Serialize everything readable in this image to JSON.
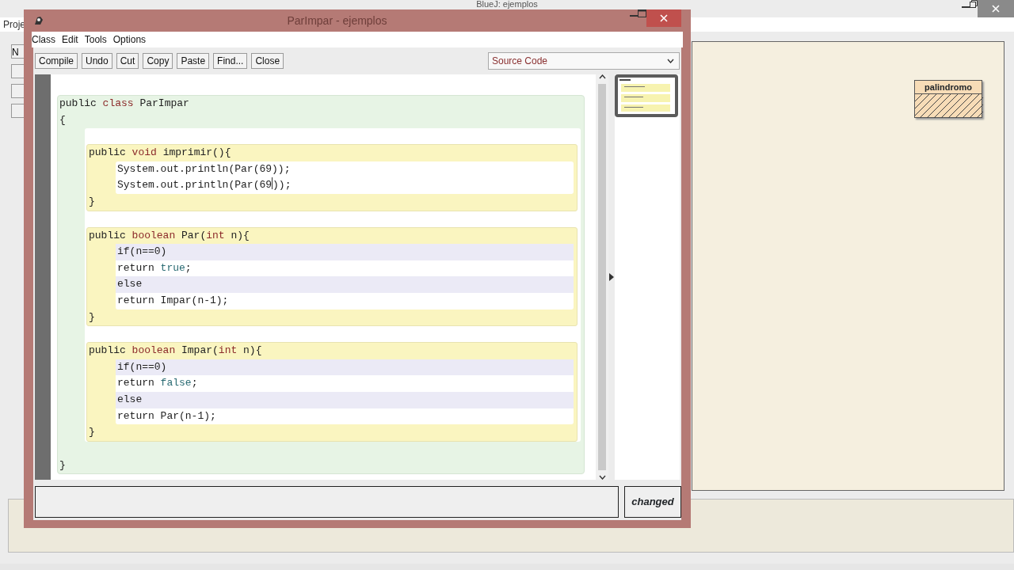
{
  "background_window": {
    "title": "BlueJ: ejemplos",
    "menu": [
      "Proje"
    ],
    "side_buttons": [
      "N"
    ],
    "classes": [
      {
        "name": "palindromo",
        "compiled": false
      }
    ]
  },
  "editor": {
    "title": "ParImpar - ejemplos",
    "menu": [
      "Class",
      "Edit",
      "Tools",
      "Options"
    ],
    "toolbar": [
      "Compile",
      "Undo",
      "Cut",
      "Copy",
      "Paste",
      "Find...",
      "Close"
    ],
    "view_select": "Source Code",
    "code": {
      "header": [
        {
          "text": "public ",
          "kind": "plain"
        },
        {
          "text": "class",
          "kind": "type"
        },
        {
          "text": " ParImpar",
          "kind": "plain"
        }
      ],
      "open": "{",
      "methods": [
        {
          "header": [
            {
              "text": "public ",
              "kind": "plain"
            },
            {
              "text": "void",
              "kind": "type"
            },
            {
              "text": " imprimir(){",
              "kind": "plain"
            }
          ],
          "body": [
            {
              "kind": "statement",
              "segments": [
                {
                  "text": "System.out.println(Par(69));",
                  "kind": "plain"
                }
              ]
            },
            {
              "kind": "statement",
              "segments": [
                {
                  "text": "System.out.println(Par(69",
                  "kind": "plain",
                  "caret": true
                },
                {
                  "text": "));",
                  "kind": "plain"
                }
              ]
            }
          ],
          "close": "}"
        },
        {
          "header": [
            {
              "text": "public ",
              "kind": "plain"
            },
            {
              "text": "boolean",
              "kind": "type"
            },
            {
              "text": " Par(",
              "kind": "plain"
            },
            {
              "text": "int",
              "kind": "type"
            },
            {
              "text": " n){",
              "kind": "plain"
            }
          ],
          "body": [
            {
              "kind": "condition",
              "segments": [
                {
                  "text": "if(n==0)",
                  "kind": "plain"
                }
              ]
            },
            {
              "kind": "statement",
              "segments": [
                {
                  "text": "return ",
                  "kind": "plain"
                },
                {
                  "text": "true",
                  "kind": "literal"
                },
                {
                  "text": ";",
                  "kind": "plain"
                }
              ]
            },
            {
              "kind": "condition",
              "segments": [
                {
                  "text": "else",
                  "kind": "plain"
                }
              ]
            },
            {
              "kind": "statement",
              "segments": [
                {
                  "text": "return Impar(n-1);",
                  "kind": "plain"
                }
              ]
            }
          ],
          "close": "}"
        },
        {
          "header": [
            {
              "text": "public ",
              "kind": "plain"
            },
            {
              "text": "boolean",
              "kind": "type"
            },
            {
              "text": " Impar(",
              "kind": "plain"
            },
            {
              "text": "int",
              "kind": "type"
            },
            {
              "text": " n){",
              "kind": "plain"
            }
          ],
          "body": [
            {
              "kind": "condition",
              "segments": [
                {
                  "text": "if(n==0)",
                  "kind": "plain"
                }
              ]
            },
            {
              "kind": "statement",
              "segments": [
                {
                  "text": "return ",
                  "kind": "plain"
                },
                {
                  "text": "false",
                  "kind": "literal"
                },
                {
                  "text": ";",
                  "kind": "plain"
                }
              ]
            },
            {
              "kind": "condition",
              "segments": [
                {
                  "text": "else",
                  "kind": "plain"
                }
              ]
            },
            {
              "kind": "statement",
              "segments": [
                {
                  "text": "return Par(n-1);",
                  "kind": "plain"
                }
              ]
            }
          ],
          "close": "}"
        }
      ],
      "close": "}"
    },
    "status": "changed"
  }
}
